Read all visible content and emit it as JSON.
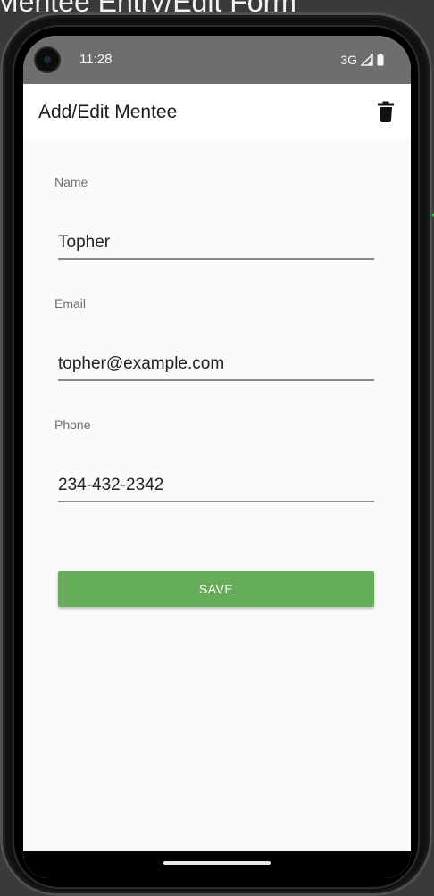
{
  "document": {
    "title": "Mentee Entry/Edit Form"
  },
  "status_bar": {
    "time": "11:28",
    "network": "3G",
    "icons": [
      "camera-icon",
      "signal-icon",
      "battery-icon"
    ]
  },
  "app_bar": {
    "title": "Add/Edit Mentee",
    "action_icon": "delete-icon"
  },
  "form": {
    "fields": [
      {
        "label": "Name",
        "value": "Topher"
      },
      {
        "label": "Email",
        "value": "topher@example.com"
      },
      {
        "label": "Phone",
        "value": "234-432-2342"
      }
    ],
    "save_label": "SAVE"
  },
  "colors": {
    "save_button": "#66ad5a",
    "annotation_arrow": "#2bd12b",
    "status_bar": "#6e6e6e"
  }
}
